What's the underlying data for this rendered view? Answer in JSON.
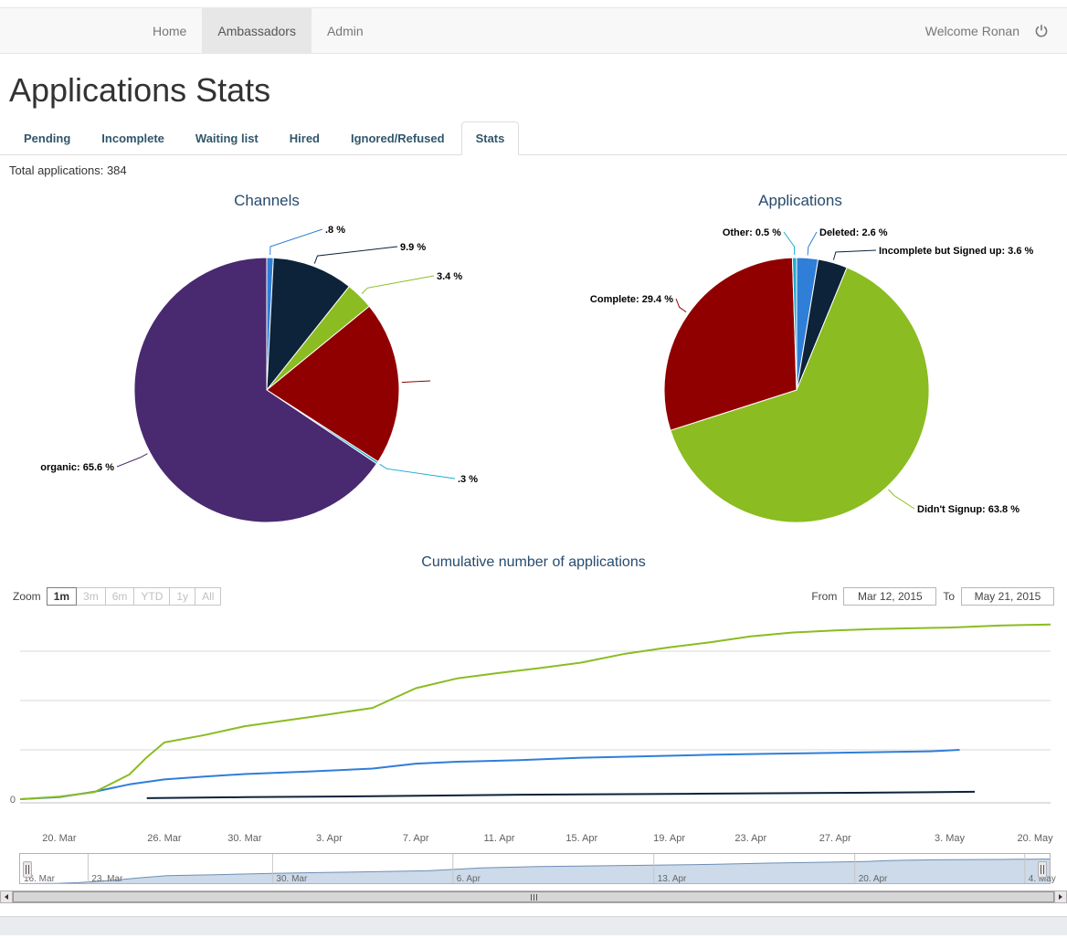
{
  "navbar": {
    "items": [
      {
        "label": "Home",
        "active": false
      },
      {
        "label": "Ambassadors",
        "active": true
      },
      {
        "label": "Admin",
        "active": false
      }
    ],
    "welcome_text": "Welcome Ronan",
    "logout_icon": "power-icon"
  },
  "page": {
    "title": "Applications Stats"
  },
  "tabs": [
    {
      "label": "Pending",
      "active": false
    },
    {
      "label": "Incomplete",
      "active": false
    },
    {
      "label": "Waiting list",
      "active": false
    },
    {
      "label": "Hired",
      "active": false
    },
    {
      "label": "Ignored/Refused",
      "active": false
    },
    {
      "label": "Stats",
      "active": true
    }
  ],
  "summary": {
    "total_applications": "Total applications: 384"
  },
  "range_selector": {
    "zoom_label": "Zoom",
    "buttons": [
      {
        "label": "1m",
        "active": true
      },
      {
        "label": "3m",
        "active": false
      },
      {
        "label": "6m",
        "active": false
      },
      {
        "label": "YTD",
        "active": false
      },
      {
        "label": "1y",
        "active": false
      },
      {
        "label": "All",
        "active": false
      }
    ],
    "from_label": "From",
    "from_value": "Mar 12, 2015",
    "to_label": "To",
    "to_value": "May 21, 2015"
  },
  "chart_data": [
    {
      "type": "pie",
      "title": "Channels",
      "center": [
        292,
        223
      ],
      "radius": 145,
      "slices": [
        {
          "name": "",
          "value": 0.8,
          "color": "#2f7ed8",
          "label": ".8 %",
          "label_at": [
            356,
            51
          ],
          "anchor": "start"
        },
        {
          "name": "",
          "value": 9.9,
          "color": "#0d233a",
          "label": "9.9 %",
          "label_at": [
            438,
            70
          ],
          "anchor": "start"
        },
        {
          "name": "",
          "value": 3.4,
          "color": "#8bbc21",
          "label": "3.4 %",
          "label_at": [
            478,
            102
          ],
          "anchor": "start"
        },
        {
          "name": "",
          "value": 20.0,
          "color": "#910000",
          "label": "",
          "label_at": [
            474,
            217
          ],
          "anchor": "start"
        },
        {
          "name": "",
          "value": 0.3,
          "color": "#1aadce",
          "label": ".3 %",
          "label_at": [
            501,
            324
          ],
          "anchor": "start"
        },
        {
          "name": "organic",
          "value": 65.6,
          "color": "#492970",
          "label": "organic: 65.6 %",
          "label_at": [
            125,
            311
          ],
          "anchor": "end"
        }
      ]
    },
    {
      "type": "pie",
      "title": "Applications",
      "center": [
        288,
        223
      ],
      "radius": 145,
      "slices": [
        {
          "name": "Deleted",
          "value": 2.6,
          "color": "#2f7ed8",
          "label": "Deleted: 2.6 %",
          "label_at": [
            313,
            54
          ],
          "anchor": "start"
        },
        {
          "name": "Incomplete but Signed up",
          "value": 3.6,
          "color": "#0d233a",
          "label": "Incomplete but Signed up: 3.6 %",
          "label_at": [
            378,
            74
          ],
          "anchor": "start"
        },
        {
          "name": "Didn't Signup",
          "value": 63.8,
          "color": "#8bbc21",
          "label": "Didn't Signup: 63.8 %",
          "label_at": [
            420,
            357
          ],
          "anchor": "start"
        },
        {
          "name": "Complete",
          "value": 29.4,
          "color": "#910000",
          "label": "Complete: 29.4 %",
          "label_at": [
            153,
            127
          ],
          "anchor": "end"
        },
        {
          "name": "Other",
          "value": 0.5,
          "color": "#1aadce",
          "label": "Other: 0.5 %",
          "label_at": [
            271,
            54
          ],
          "anchor": "end"
        }
      ]
    },
    {
      "type": "line",
      "title": "Cumulative number of applications",
      "y_axis": {
        "min_label": "0",
        "gridlines": [
          100,
          200,
          300
        ],
        "max": 380
      },
      "x_axis": {
        "ticks": [
          {
            "label": "20. Mar",
            "day": 4,
            "frac": 0.038
          },
          {
            "label": "26. Mar",
            "day": 10,
            "frac": 0.14
          },
          {
            "label": "30. Mar",
            "day": 14,
            "frac": 0.218
          },
          {
            "label": "3. Apr",
            "day": 18,
            "frac": 0.3
          },
          {
            "label": "7. Apr",
            "day": 22,
            "frac": 0.384
          },
          {
            "label": "11. Apr",
            "day": 26,
            "frac": 0.465
          },
          {
            "label": "15. Apr",
            "day": 30,
            "frac": 0.545
          },
          {
            "label": "19. Apr",
            "day": 34,
            "frac": 0.63
          },
          {
            "label": "23. Apr",
            "day": 38,
            "frac": 0.709
          },
          {
            "label": "27. Apr",
            "day": 42,
            "frac": 0.791
          },
          {
            "label": "3. May",
            "day": 48,
            "frac": 0.902
          },
          {
            "label": "20. May",
            "day": 65,
            "frac": 0.985
          }
        ]
      },
      "series": [
        {
          "name": "series-blue",
          "color": "#2f7ed8",
          "points": [
            [
              "Mar 16",
              0
            ],
            [
              "Mar 20",
              4
            ],
            [
              "Mar 22",
              15
            ],
            [
              "Mar 24",
              30
            ],
            [
              "Mar 26",
              40
            ],
            [
              "Mar 28",
              46
            ],
            [
              "Mar 30",
              51
            ],
            [
              "Apr 2",
              56
            ],
            [
              "Apr 5",
              62
            ],
            [
              "Apr 7",
              72
            ],
            [
              "Apr 9",
              76
            ],
            [
              "Apr 12",
              79
            ],
            [
              "Apr 15",
              84
            ],
            [
              "Apr 18",
              87
            ],
            [
              "Apr 21",
              90
            ],
            [
              "Apr 24",
              92
            ],
            [
              "Apr 27",
              94
            ],
            [
              "Apr 30",
              96
            ],
            [
              "May 2",
              97
            ],
            [
              "May 5",
              100
            ]
          ]
        },
        {
          "name": "series-dark",
          "color": "#0d233a",
          "points": [
            [
              "Mar 25",
              2
            ],
            [
              "Mar 30",
              4
            ],
            [
              "Apr 5",
              6
            ],
            [
              "Apr 12",
              9
            ],
            [
              "Apr 20",
              11
            ],
            [
              "Apr 28",
              13
            ],
            [
              "May 8",
              15
            ]
          ]
        },
        {
          "name": "series-green",
          "color": "#8bbc21",
          "points": [
            [
              "Mar 16",
              0
            ],
            [
              "Mar 20",
              5
            ],
            [
              "Mar 22",
              14
            ],
            [
              "Mar 24",
              50
            ],
            [
              "Mar 25",
              85
            ],
            [
              "Mar 26",
              115
            ],
            [
              "Mar 28",
              130
            ],
            [
              "Mar 30",
              148
            ],
            [
              "Apr 1",
              160
            ],
            [
              "Apr 3",
              172
            ],
            [
              "Apr 5",
              185
            ],
            [
              "Apr 7",
              225
            ],
            [
              "Apr 9",
              245
            ],
            [
              "Apr 11",
              256
            ],
            [
              "Apr 13",
              266
            ],
            [
              "Apr 15",
              277
            ],
            [
              "Apr 17",
              295
            ],
            [
              "Apr 19",
              308
            ],
            [
              "Apr 21",
              318
            ],
            [
              "Apr 23",
              330
            ],
            [
              "Apr 25",
              338
            ],
            [
              "Apr 27",
              342
            ],
            [
              "Apr 29",
              345
            ],
            [
              "May 3",
              348
            ],
            [
              "May 8",
              350
            ],
            [
              "May 13",
              352
            ],
            [
              "May 17",
              353
            ],
            [
              "May 21",
              354
            ]
          ]
        }
      ],
      "navigator": {
        "ticks": [
          {
            "label": "16. Mar",
            "frac": 0.0
          },
          {
            "label": "23. Mar",
            "frac": 0.066
          },
          {
            "label": "30. Mar",
            "frac": 0.245
          },
          {
            "label": "6. Apr",
            "frac": 0.42
          },
          {
            "label": "13. Apr",
            "frac": 0.615
          },
          {
            "label": "20. Apr",
            "frac": 0.81
          },
          {
            "label": "4. May",
            "frac": 0.975
          }
        ],
        "day_fracs": [
          [
            0,
            0
          ],
          [
            7,
            0.066
          ],
          [
            14,
            0.245
          ],
          [
            21,
            0.42
          ],
          [
            28,
            0.615
          ],
          [
            35,
            0.81
          ],
          [
            49,
            0.96
          ],
          [
            66,
            1.0
          ]
        ],
        "area_fill": "#ccdae9",
        "area_line": "#6f8eb5"
      }
    }
  ]
}
